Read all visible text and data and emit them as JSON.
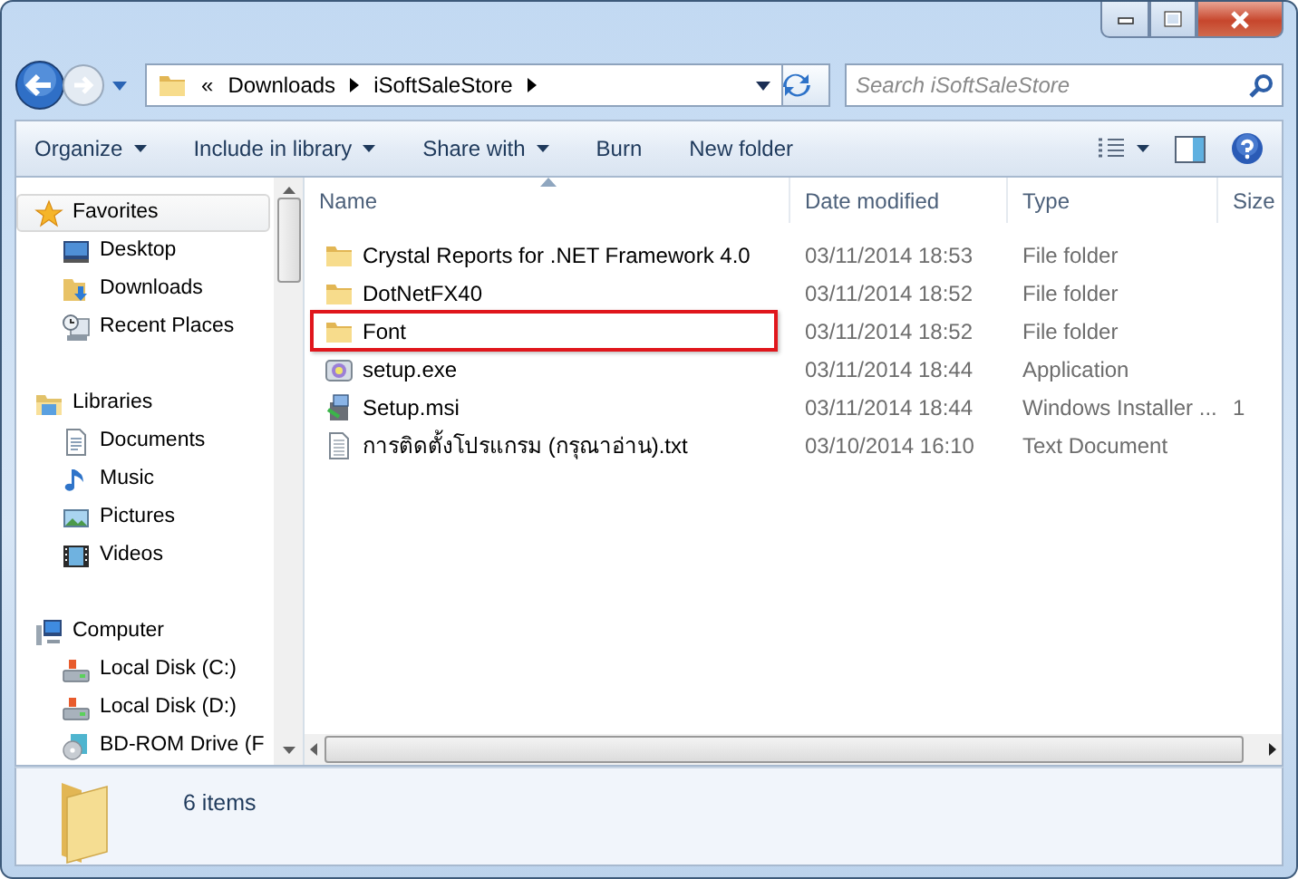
{
  "address": {
    "overflow": "«",
    "path": [
      "Downloads",
      "iSoftSaleStore"
    ]
  },
  "search": {
    "placeholder": "Search iSoftSaleStore"
  },
  "toolbar": [
    {
      "label": "Organize",
      "menu": true
    },
    {
      "label": "Include in library",
      "menu": true
    },
    {
      "label": "Share with",
      "menu": true
    },
    {
      "label": "Burn",
      "menu": false
    },
    {
      "label": "New folder",
      "menu": false
    }
  ],
  "sidebar": [
    {
      "label": "Favorites",
      "kind": "star",
      "selected": true,
      "children": [
        {
          "label": "Desktop",
          "kind": "desktop",
          "selected": false
        },
        {
          "label": "Downloads",
          "kind": "downloads",
          "selected": false
        },
        {
          "label": "Recent Places",
          "kind": "recent",
          "selected": false
        }
      ]
    },
    {
      "label": "Libraries",
      "kind": "libraries",
      "selected": false,
      "children": [
        {
          "label": "Documents",
          "kind": "document",
          "selected": false
        },
        {
          "label": "Music",
          "kind": "music",
          "selected": false
        },
        {
          "label": "Pictures",
          "kind": "pictures",
          "selected": false
        },
        {
          "label": "Videos",
          "kind": "videos",
          "selected": false
        }
      ]
    },
    {
      "label": "Computer",
      "kind": "computer",
      "selected": false,
      "children": [
        {
          "label": "Local Disk (C:)",
          "kind": "disk",
          "selected": false
        },
        {
          "label": "Local Disk (D:)",
          "kind": "disk",
          "selected": false
        },
        {
          "label": "BD-ROM Drive (F",
          "kind": "optical",
          "selected": false
        }
      ]
    }
  ],
  "columns": [
    {
      "label": "Name",
      "sorted": true
    },
    {
      "label": "Date modified",
      "sorted": false
    },
    {
      "label": "Type",
      "sorted": false
    },
    {
      "label": "Size",
      "sorted": false
    }
  ],
  "rows": [
    {
      "name": "Crystal Reports for .NET Framework 4.0",
      "date": "03/11/2014 18:53",
      "type": "File folder",
      "kind": "folder",
      "highlighted": false
    },
    {
      "name": "DotNetFX40",
      "date": "03/11/2014 18:52",
      "type": "File folder",
      "kind": "folder",
      "highlighted": false
    },
    {
      "name": "Font",
      "date": "03/11/2014 18:52",
      "type": "File folder",
      "kind": "folder",
      "highlighted": true
    },
    {
      "name": "setup.exe",
      "date": "03/11/2014 18:44",
      "type": "Application",
      "kind": "exe",
      "highlighted": false
    },
    {
      "name": "Setup.msi",
      "date": "03/11/2014 18:44",
      "type": "Windows Installer ...",
      "size": "1",
      "kind": "msi",
      "highlighted": false
    },
    {
      "name": "การติดตั้งโปรแกรม (กรุณาอ่าน).txt",
      "date": "03/10/2014 16:10",
      "type": "Text Document",
      "kind": "text",
      "highlighted": false
    }
  ],
  "status": {
    "text": "6 items"
  }
}
